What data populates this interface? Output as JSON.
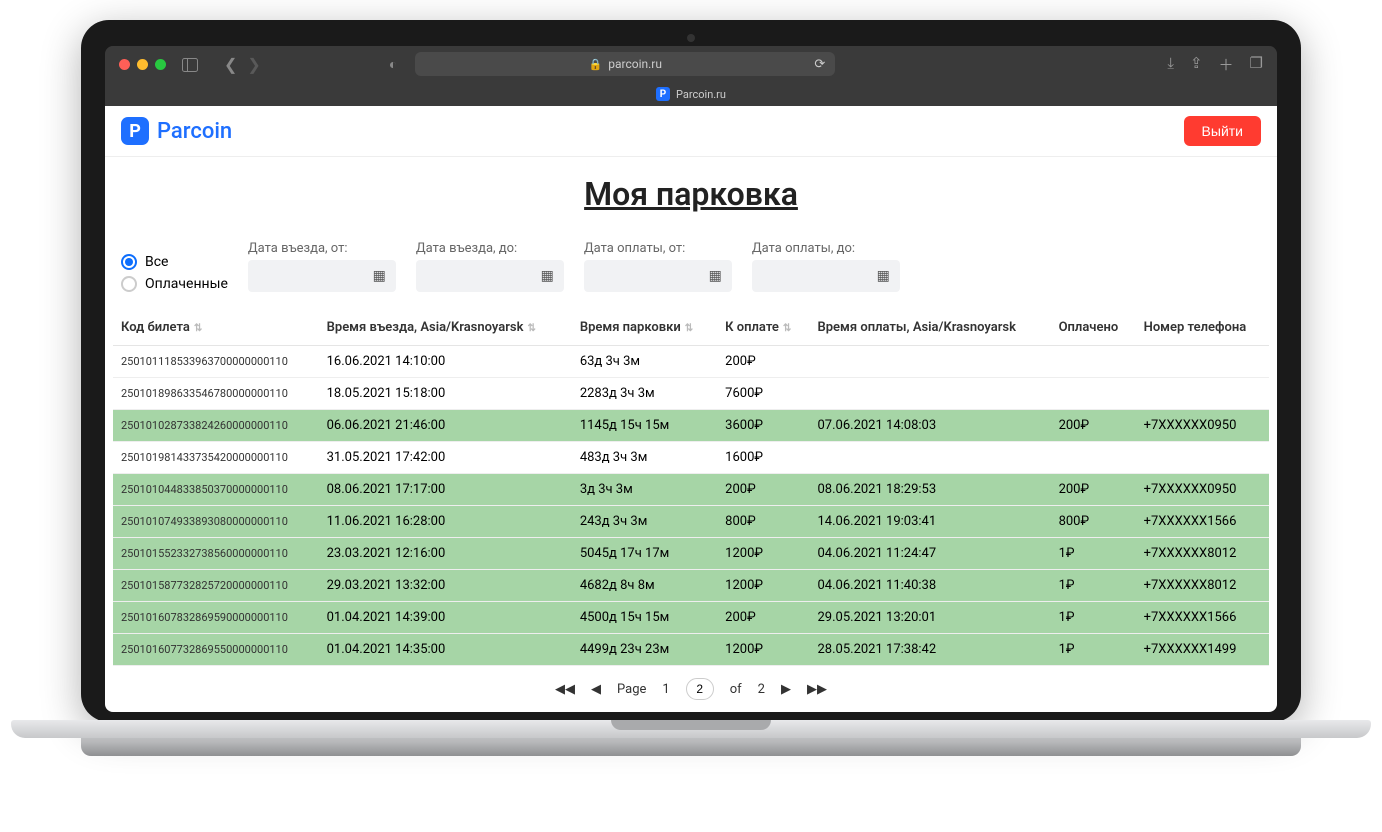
{
  "browser": {
    "domain": "parcoin.ru",
    "tab_title": "Parcoin.ru"
  },
  "header": {
    "brand": "Parcoin",
    "logout": "Выйти"
  },
  "title": "Моя парковка",
  "filters": {
    "radio_all": "Все",
    "radio_paid": "Оплаченные",
    "date_in_from": "Дата въезда, от:",
    "date_in_to": "Дата въезда, до:",
    "date_pay_from": "Дата оплаты, от:",
    "date_pay_to": "Дата оплаты, до:"
  },
  "columns": {
    "ticket": "Код билета",
    "entry": "Время въезда, Asia/Krasnoyarsk",
    "parking": "Время парковки",
    "due": "К оплате",
    "pay_time": "Время оплаты, Asia/Krasnoyarsk",
    "paid": "Оплачено",
    "phone": "Номер телефона"
  },
  "rows": [
    {
      "paid": false,
      "ticket": "250101118533963700000000110",
      "entry": "16.06.2021 14:10:00",
      "parking": "63д 3ч 3м",
      "due": "200₽",
      "pay_time": "",
      "amount": "",
      "phone": ""
    },
    {
      "paid": false,
      "ticket": "250101898633546780000000110",
      "entry": "18.05.2021 15:18:00",
      "parking": "2283д 3ч 3м",
      "due": "7600₽",
      "pay_time": "",
      "amount": "",
      "phone": ""
    },
    {
      "paid": true,
      "ticket": "250101028733824260000000110",
      "entry": "06.06.2021 21:46:00",
      "parking": "1145д 15ч 15м",
      "due": "3600₽",
      "pay_time": "07.06.2021 14:08:03",
      "amount": "200₽",
      "phone": "+7XXXXXX0950"
    },
    {
      "paid": false,
      "ticket": "250101981433735420000000110",
      "entry": "31.05.2021 17:42:00",
      "parking": "483д 3ч 3м",
      "due": "1600₽",
      "pay_time": "",
      "amount": "",
      "phone": ""
    },
    {
      "paid": true,
      "ticket": "250101044833850370000000110",
      "entry": "08.06.2021 17:17:00",
      "parking": "3д 3ч 3м",
      "due": "200₽",
      "pay_time": "08.06.2021 18:29:53",
      "amount": "200₽",
      "phone": "+7XXXXXX0950"
    },
    {
      "paid": true,
      "ticket": "250101074933893080000000110",
      "entry": "11.06.2021 16:28:00",
      "parking": "243д 3ч 3м",
      "due": "800₽",
      "pay_time": "14.06.2021 19:03:41",
      "amount": "800₽",
      "phone": "+7XXXXXX1566"
    },
    {
      "paid": true,
      "ticket": "250101552332738560000000110",
      "entry": "23.03.2021 12:16:00",
      "parking": "5045д 17ч 17м",
      "due": "1200₽",
      "pay_time": "04.06.2021 11:24:47",
      "amount": "1₽",
      "phone": "+7XXXXXX8012"
    },
    {
      "paid": true,
      "ticket": "250101587732825720000000110",
      "entry": "29.03.2021 13:32:00",
      "parking": "4682д 8ч 8м",
      "due": "1200₽",
      "pay_time": "04.06.2021 11:40:38",
      "amount": "1₽",
      "phone": "+7XXXXXX8012"
    },
    {
      "paid": true,
      "ticket": "250101607832869590000000110",
      "entry": "01.04.2021 14:39:00",
      "parking": "4500д 15ч 15м",
      "due": "200₽",
      "pay_time": "29.05.2021 13:20:01",
      "amount": "1₽",
      "phone": "+7XXXXXX1566"
    },
    {
      "paid": true,
      "ticket": "250101607732869550000000110",
      "entry": "01.04.2021 14:35:00",
      "parking": "4499д 23ч 23м",
      "due": "1200₽",
      "pay_time": "28.05.2021 17:38:42",
      "amount": "1₽",
      "phone": "+7XXXXXX1499"
    }
  ],
  "pagination": {
    "page_label": "Page",
    "current": "1",
    "input": "2",
    "of": "of",
    "total": "2"
  }
}
